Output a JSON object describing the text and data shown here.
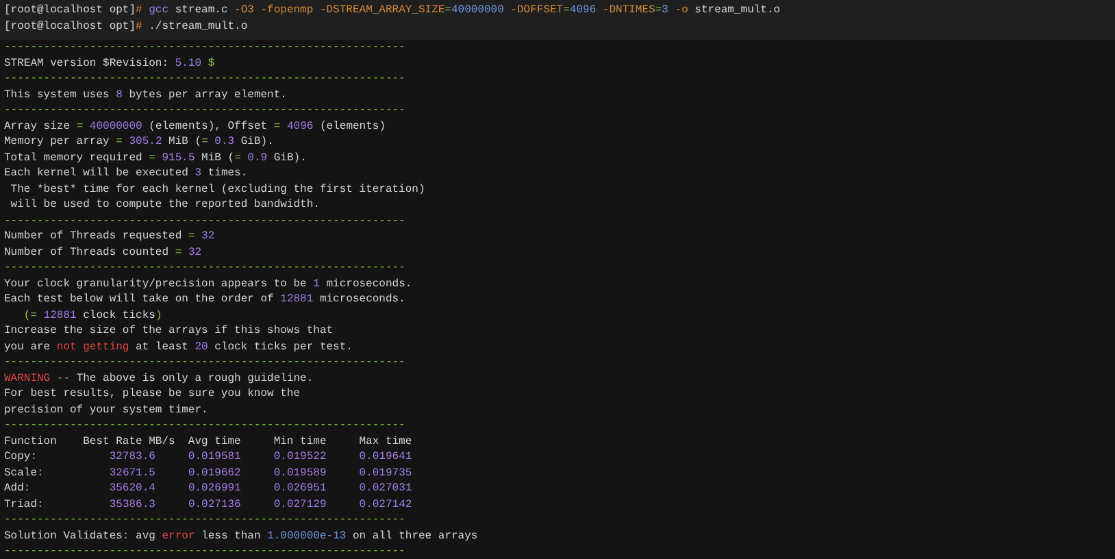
{
  "lines": [
    {
      "kind": "command",
      "segments": [
        {
          "text": "[root@localhost opt]",
          "kind": "plain"
        },
        {
          "text": "#",
          "kind": "hash"
        },
        {
          "text": " gcc",
          "kind": "cmd"
        },
        {
          "text": " stream.c ",
          "kind": "plain"
        },
        {
          "text": "-O3 -fopenmp -DSTREAM_ARRAY_SIZE",
          "kind": "flag"
        },
        {
          "text": "=",
          "kind": "op"
        },
        {
          "text": "40000000",
          "kind": "arg"
        },
        {
          "text": " -DOFFSET",
          "kind": "flag"
        },
        {
          "text": "=",
          "kind": "op"
        },
        {
          "text": "4096",
          "kind": "arg"
        },
        {
          "text": " -DNTIMES",
          "kind": "flag"
        },
        {
          "text": "=",
          "kind": "op"
        },
        {
          "text": "3",
          "kind": "arg"
        },
        {
          "text": " -o",
          "kind": "flag"
        },
        {
          "text": " stream_mult.o",
          "kind": "plain"
        }
      ]
    },
    {
      "kind": "command",
      "segments": [
        {
          "text": "[root@localhost opt]",
          "kind": "plain"
        },
        {
          "text": "#",
          "kind": "hash"
        },
        {
          "text": " ./stream_mult.o",
          "kind": "plain"
        }
      ]
    },
    {
      "kind": "rule",
      "segments": [
        {
          "text": "-------------------------------------------------------------",
          "kind": "op"
        }
      ]
    },
    {
      "kind": "output",
      "segments": [
        {
          "text": "STREAM version $Revision: ",
          "kind": "plain"
        },
        {
          "text": "5.10",
          "kind": "num"
        },
        {
          "text": " $",
          "kind": "op"
        }
      ]
    },
    {
      "kind": "rule",
      "segments": [
        {
          "text": "-------------------------------------------------------------",
          "kind": "op"
        }
      ]
    },
    {
      "kind": "output",
      "segments": [
        {
          "text": "This system uses ",
          "kind": "plain"
        },
        {
          "text": "8",
          "kind": "num"
        },
        {
          "text": " bytes per array element.",
          "kind": "plain"
        }
      ]
    },
    {
      "kind": "rule",
      "segments": [
        {
          "text": "-------------------------------------------------------------",
          "kind": "op"
        }
      ]
    },
    {
      "kind": "output",
      "segments": [
        {
          "text": "Array size ",
          "kind": "plain"
        },
        {
          "text": "=",
          "kind": "op"
        },
        {
          "text": " 40000000",
          "kind": "num"
        },
        {
          "text": " (elements), Offset ",
          "kind": "plain"
        },
        {
          "text": "=",
          "kind": "op"
        },
        {
          "text": " 4096",
          "kind": "num"
        },
        {
          "text": " (elements)",
          "kind": "plain"
        }
      ]
    },
    {
      "kind": "output",
      "segments": [
        {
          "text": "Memory per array ",
          "kind": "plain"
        },
        {
          "text": "=",
          "kind": "op"
        },
        {
          "text": " 305.2",
          "kind": "num"
        },
        {
          "text": " MiB (",
          "kind": "plain"
        },
        {
          "text": "=",
          "kind": "op"
        },
        {
          "text": " 0.3",
          "kind": "num"
        },
        {
          "text": " GiB).",
          "kind": "plain"
        }
      ]
    },
    {
      "kind": "output",
      "segments": [
        {
          "text": "Total memory required ",
          "kind": "plain"
        },
        {
          "text": "=",
          "kind": "op"
        },
        {
          "text": " 915.5",
          "kind": "num"
        },
        {
          "text": " MiB (",
          "kind": "plain"
        },
        {
          "text": "=",
          "kind": "op"
        },
        {
          "text": " 0.9",
          "kind": "num"
        },
        {
          "text": " GiB).",
          "kind": "plain"
        }
      ]
    },
    {
      "kind": "output",
      "segments": [
        {
          "text": "Each kernel will be executed ",
          "kind": "plain"
        },
        {
          "text": "3",
          "kind": "num"
        },
        {
          "text": " times.",
          "kind": "plain"
        }
      ]
    },
    {
      "kind": "output",
      "segments": [
        {
          "text": " The *best* time for each kernel (excluding the first iteration)",
          "kind": "plain"
        }
      ]
    },
    {
      "kind": "output",
      "segments": [
        {
          "text": " will be used to compute the reported bandwidth.",
          "kind": "plain"
        }
      ]
    },
    {
      "kind": "rule",
      "segments": [
        {
          "text": "-------------------------------------------------------------",
          "kind": "op"
        }
      ]
    },
    {
      "kind": "output",
      "segments": [
        {
          "text": "Number of Threads requested ",
          "kind": "plain"
        },
        {
          "text": "=",
          "kind": "op"
        },
        {
          "text": " 32",
          "kind": "num"
        }
      ]
    },
    {
      "kind": "output",
      "segments": [
        {
          "text": "Number of Threads counted ",
          "kind": "plain"
        },
        {
          "text": "=",
          "kind": "op"
        },
        {
          "text": " 32",
          "kind": "num"
        }
      ]
    },
    {
      "kind": "rule",
      "segments": [
        {
          "text": "-------------------------------------------------------------",
          "kind": "op"
        }
      ]
    },
    {
      "kind": "output",
      "segments": [
        {
          "text": "Your clock granularity/precision appears to be ",
          "kind": "plain"
        },
        {
          "text": "1",
          "kind": "num"
        },
        {
          "text": " microseconds.",
          "kind": "plain"
        }
      ]
    },
    {
      "kind": "output",
      "segments": [
        {
          "text": "Each test below will take on the order of ",
          "kind": "plain"
        },
        {
          "text": "12881",
          "kind": "num"
        },
        {
          "text": " microseconds.",
          "kind": "plain"
        }
      ]
    },
    {
      "kind": "output",
      "segments": [
        {
          "text": "   (=",
          "kind": "op"
        },
        {
          "text": " 12881",
          "kind": "num"
        },
        {
          "text": " clock ticks",
          "kind": "plain"
        },
        {
          "text": ")",
          "kind": "op"
        }
      ]
    },
    {
      "kind": "output",
      "segments": [
        {
          "text": "Increase the size of the arrays if this shows that",
          "kind": "plain"
        }
      ]
    },
    {
      "kind": "output",
      "segments": [
        {
          "text": "you are ",
          "kind": "plain"
        },
        {
          "text": "not getting",
          "kind": "err"
        },
        {
          "text": " at least ",
          "kind": "plain"
        },
        {
          "text": "20",
          "kind": "num"
        },
        {
          "text": " clock ticks per test.",
          "kind": "plain"
        }
      ]
    },
    {
      "kind": "rule",
      "segments": [
        {
          "text": "-------------------------------------------------------------",
          "kind": "op"
        }
      ]
    },
    {
      "kind": "output",
      "segments": [
        {
          "text": "WARNING",
          "kind": "err"
        },
        {
          "text": " -- ",
          "kind": "op"
        },
        {
          "text": "The above is only a rough guideline.",
          "kind": "plain"
        }
      ]
    },
    {
      "kind": "output",
      "segments": [
        {
          "text": "For best results, please be sure you know the",
          "kind": "plain"
        }
      ]
    },
    {
      "kind": "output",
      "segments": [
        {
          "text": "precision of your system timer.",
          "kind": "plain"
        }
      ]
    },
    {
      "kind": "rule",
      "segments": [
        {
          "text": "-------------------------------------------------------------",
          "kind": "op"
        }
      ]
    },
    {
      "kind": "output",
      "segments": [
        {
          "text": "Function    Best Rate MB/s  Avg time     Min time     Max time",
          "kind": "plain"
        }
      ]
    },
    {
      "kind": "output",
      "segments": [
        {
          "text": "Copy",
          "kind": "plain"
        },
        {
          "text": ":",
          "kind": "op"
        },
        {
          "text": "           32783.6     0.019581     0.019522     0.019641",
          "kind": "num"
        }
      ]
    },
    {
      "kind": "output",
      "segments": [
        {
          "text": "Scale",
          "kind": "plain"
        },
        {
          "text": ":",
          "kind": "op"
        },
        {
          "text": "          32671.5     0.019662     0.019589     0.019735",
          "kind": "num"
        }
      ]
    },
    {
      "kind": "output",
      "segments": [
        {
          "text": "Add",
          "kind": "plain"
        },
        {
          "text": ":",
          "kind": "op"
        },
        {
          "text": "            35620.4     0.026991     0.026951     0.027031",
          "kind": "num"
        }
      ]
    },
    {
      "kind": "output",
      "segments": [
        {
          "text": "Triad",
          "kind": "plain"
        },
        {
          "text": ":",
          "kind": "op"
        },
        {
          "text": "          35386.3     0.027136     0.027129     0.027142",
          "kind": "num"
        }
      ]
    },
    {
      "kind": "rule",
      "segments": [
        {
          "text": "-------------------------------------------------------------",
          "kind": "op"
        }
      ]
    },
    {
      "kind": "output",
      "segments": [
        {
          "text": "Solution Validates",
          "kind": "plain"
        },
        {
          "text": ":",
          "kind": "op"
        },
        {
          "text": " avg ",
          "kind": "plain"
        },
        {
          "text": "error",
          "kind": "err"
        },
        {
          "text": " less than ",
          "kind": "plain"
        },
        {
          "text": "1.000000e-13",
          "kind": "arg"
        },
        {
          "text": " on all three arrays",
          "kind": "plain"
        }
      ]
    },
    {
      "kind": "rule",
      "segments": [
        {
          "text": "-------------------------------------------------------------",
          "kind": "op"
        }
      ]
    }
  ]
}
